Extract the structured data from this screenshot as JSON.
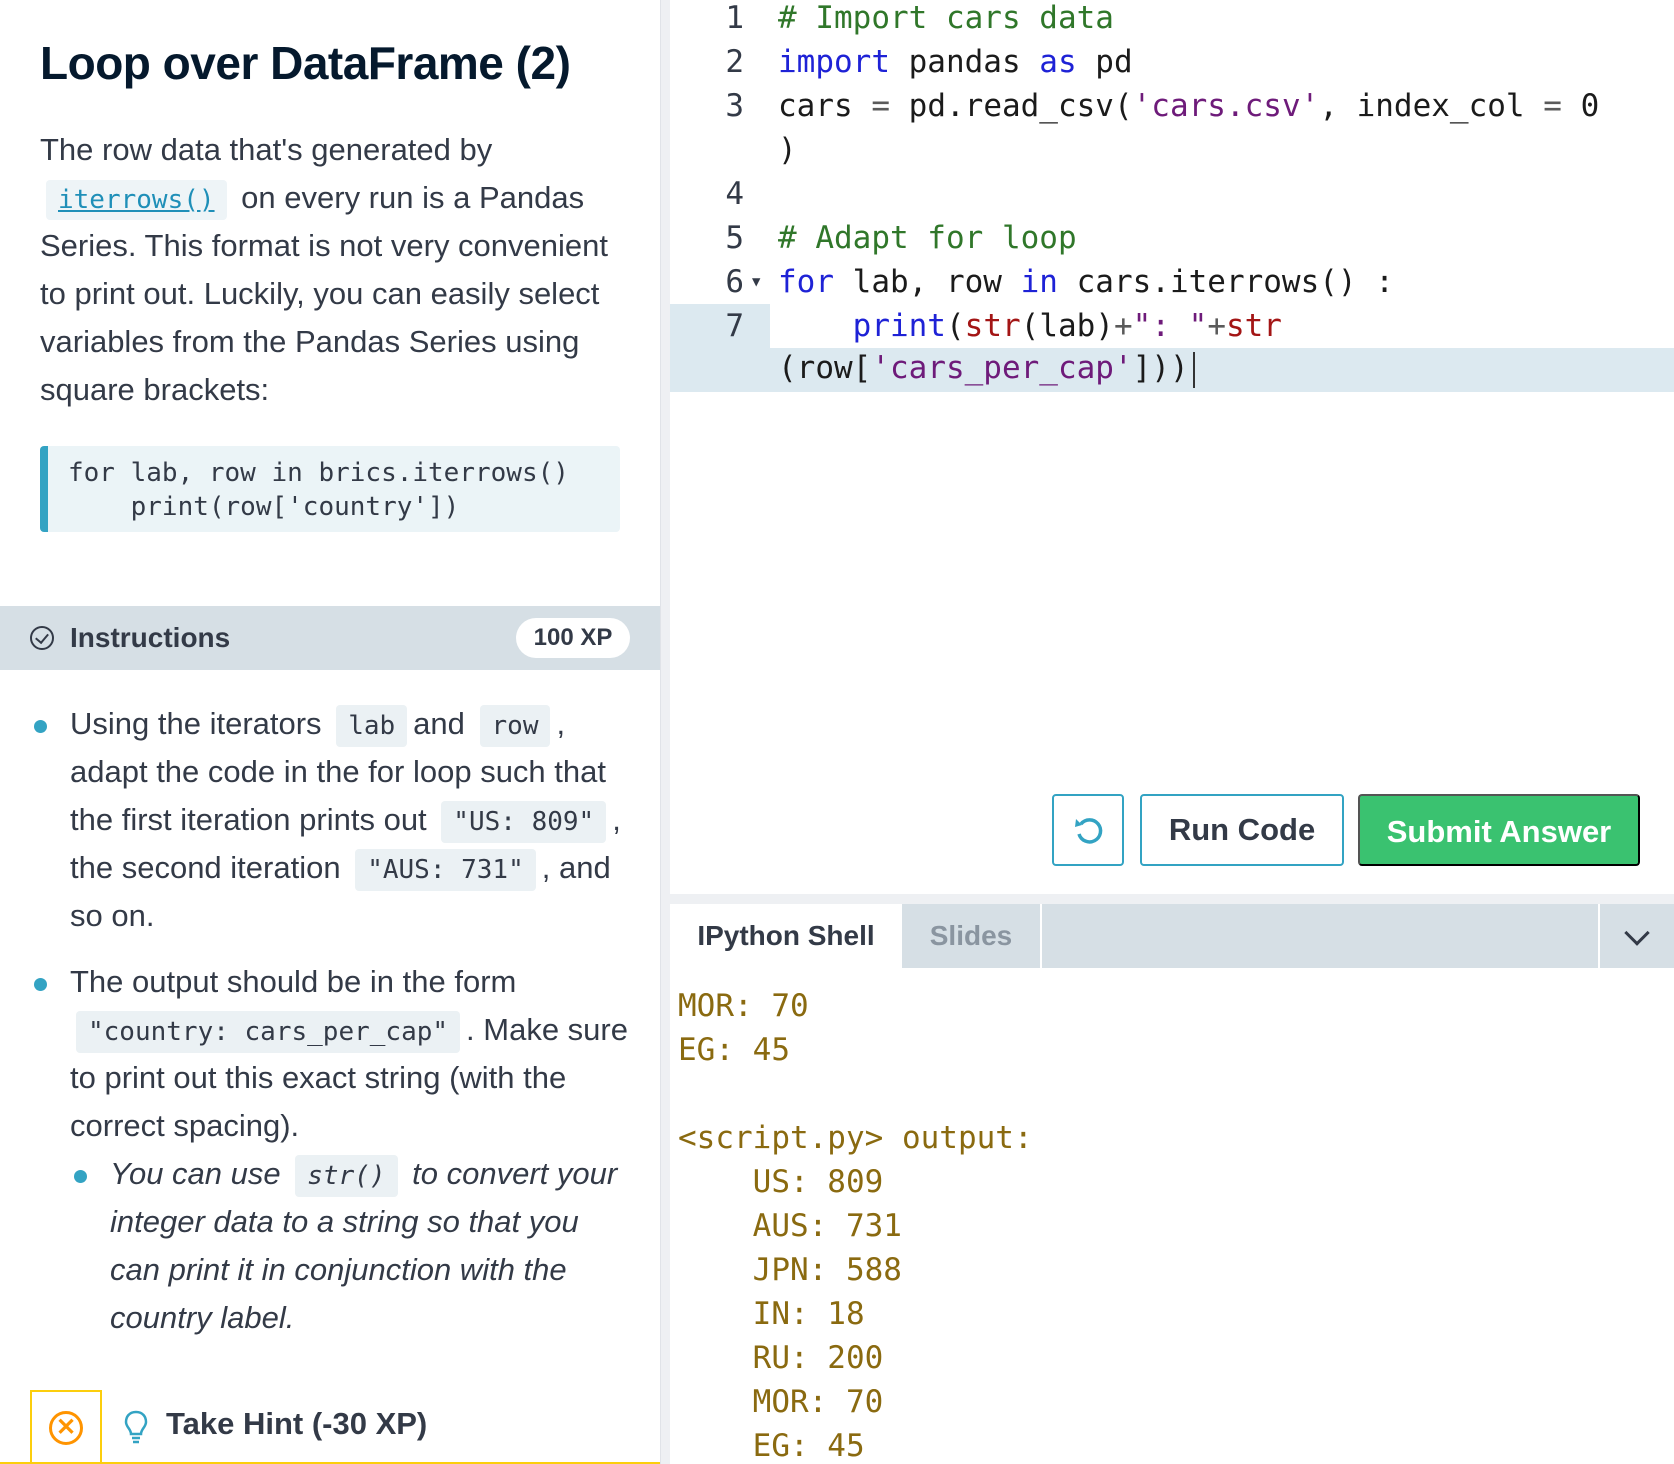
{
  "exercise": {
    "title": "Loop over DataFrame (2)",
    "intro_before": "The row data that's generated by",
    "intro_link": "iterrows()",
    "intro_after": "on every run is a Pandas Series. This format is not very convenient to print out. Luckily, you can easily select variables from the Pandas Series using square brackets:",
    "snippet": "for lab, row in brics.iterrows()\n    print(row['country'])"
  },
  "instructions": {
    "label": "Instructions",
    "xp": "100 XP",
    "b1_t1": "Using the iterators",
    "b1_c1": "lab",
    "b1_t2": "and",
    "b1_c2": "row",
    "b1_t3": ", adapt the code in the for loop such that the first iteration prints out",
    "b1_c3": "\"US: 809\"",
    "b1_t4": ", the second iteration",
    "b1_c4": "\"AUS: 731\"",
    "b1_t5": ", and so on.",
    "b2_t1": "The output should be in the form",
    "b2_c1": "\"country: cars_per_cap\"",
    "b2_t2": ". Make sure to print out this exact string (with the correct spacing).",
    "sub_t1": "You can use",
    "sub_c1": "str()",
    "sub_t2": "to convert your integer data to a string so that you can print it in conjunction with the country label."
  },
  "hint": {
    "close_symbol": "✕",
    "label": "Take Hint (-30 XP)"
  },
  "editor": {
    "line_numbers": [
      "1",
      "2",
      "3",
      "4",
      "5",
      "6",
      "7"
    ],
    "active_line": 7,
    "folded_line": 6
  },
  "buttons": {
    "reset_icon": "undo-icon",
    "run": "Run Code",
    "submit": "Submit Answer"
  },
  "console": {
    "tab_shell": "IPython Shell",
    "tab_slides": "Slides",
    "output": "MOR: 70\nEG: 45\n\n<script.py> output:\n    US: 809\n    AUS: 731\n    JPN: 588\n    IN: 18\n    RU: 200\n    MOR: 70\n    EG: 45"
  },
  "colors": {
    "accent": "#33a3c3",
    "submit": "#3ac270",
    "hint": "#fcce0d",
    "output": "#8a6a10"
  }
}
